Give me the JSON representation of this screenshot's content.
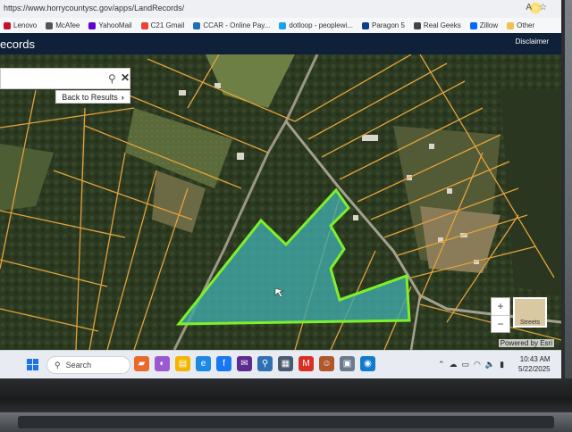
{
  "browser": {
    "url": "https://www.horrycountysc.gov/apps/LandRecords/",
    "toolbar_icons": [
      "font-size-icon",
      "star-icon",
      "profile-icon"
    ]
  },
  "bookmarks": [
    {
      "label": "Lenovo",
      "color": "#c8102e"
    },
    {
      "label": "McAfee",
      "color": "#555555"
    },
    {
      "label": "YahooMail",
      "color": "#6001d2"
    },
    {
      "label": "C21 Gmail",
      "color": "#ea4335"
    },
    {
      "label": "CCAR - Online Pay...",
      "color": "#1f6fb2"
    },
    {
      "label": "dotloop - peoplewi...",
      "color": "#1aa3e8"
    },
    {
      "label": "Paragon 5",
      "color": "#0b3d91"
    },
    {
      "label": "Real Geeks",
      "color": "#444444"
    },
    {
      "label": "Zillow",
      "color": "#006aff"
    },
    {
      "label": "Other",
      "color": "#f2c14e"
    }
  ],
  "app": {
    "title": "ecords",
    "disclaimer": "Disclaimer"
  },
  "map": {
    "search_placeholder": "",
    "back_label": "Back to Results",
    "zoom_in": "+",
    "zoom_out": "−",
    "basemap_label": "Streets",
    "attribution": "Powered by Esri",
    "parcel_line_color": "#e3a23c",
    "highlight_color": "#7ef02a",
    "highlight_fill": "#3fa7a6"
  },
  "taskbar": {
    "search_label": "Search",
    "apps": [
      {
        "name": "widgets-icon",
        "color": "#e86a2a",
        "glyph": "▰"
      },
      {
        "name": "copilot-icon",
        "color": "#9b59d0",
        "glyph": "◐"
      },
      {
        "name": "file-explorer-icon",
        "color": "#f4b400",
        "glyph": "▤"
      },
      {
        "name": "edge-icon",
        "color": "#1e88e5",
        "glyph": "e"
      },
      {
        "name": "facebook-icon",
        "color": "#1877f2",
        "glyph": "f"
      },
      {
        "name": "mail-icon",
        "color": "#5c2d91",
        "glyph": "✉"
      },
      {
        "name": "network-app-icon",
        "color": "#2f6fb4",
        "glyph": "⚲"
      },
      {
        "name": "app-icon",
        "color": "#4a5a70",
        "glyph": "▦"
      },
      {
        "name": "gmail-icon",
        "color": "#d93025",
        "glyph": "M"
      },
      {
        "name": "person-app-icon",
        "color": "#b0582a",
        "glyph": "☺"
      },
      {
        "name": "photos-icon",
        "color": "#6b7b8c",
        "glyph": "▣"
      },
      {
        "name": "edge-browser-icon",
        "color": "#0f7bcf",
        "glyph": "◉"
      }
    ],
    "tray_icons": [
      "chevron-up-icon",
      "cloud-icon",
      "display-icon",
      "wifi-icon",
      "volume-icon",
      "battery-icon"
    ],
    "time": "10:43 AM",
    "date": "5/22/2025"
  }
}
